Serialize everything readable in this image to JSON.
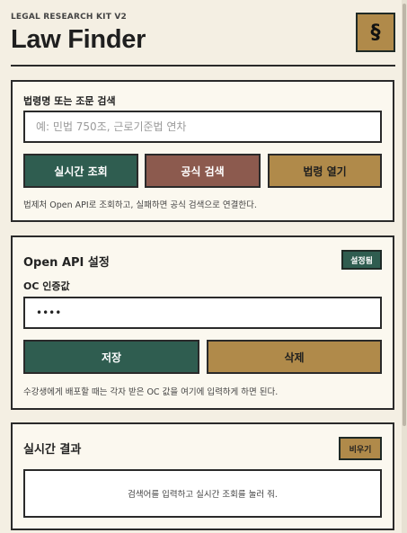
{
  "header": {
    "kicker": "LEGAL RESEARCH KIT V2",
    "title": "Law Finder",
    "logo_symbol": "§"
  },
  "search": {
    "label": "법령명 또는 조문 검색",
    "placeholder": "예: 민법 750조, 근로기준법 연차",
    "realtime_button": "실시간 조회",
    "official_button": "공식 검색",
    "open_button": "법령 열기",
    "hint": "법제처 Open API로 조회하고, 실패하면 공식 검색으로 연결한다."
  },
  "api": {
    "title": "Open API 설정",
    "status_badge": "설정됨",
    "oc_label": "OC 인증값",
    "oc_value": "••••",
    "save_button": "저장",
    "delete_button": "삭제",
    "hint": "수강생에게 배포할 때는 각자 받은 OC 값을 여기에 입력하게 하면 된다."
  },
  "results": {
    "title": "실시간 결과",
    "clear_button": "비우기",
    "empty_message": "검색어를 입력하고 실시간 조회를 눌러 줘."
  },
  "colors": {
    "background": "#f4efe3",
    "green": "#2f5d50",
    "rust": "#8c5a4e",
    "tan": "#b08a4a"
  }
}
